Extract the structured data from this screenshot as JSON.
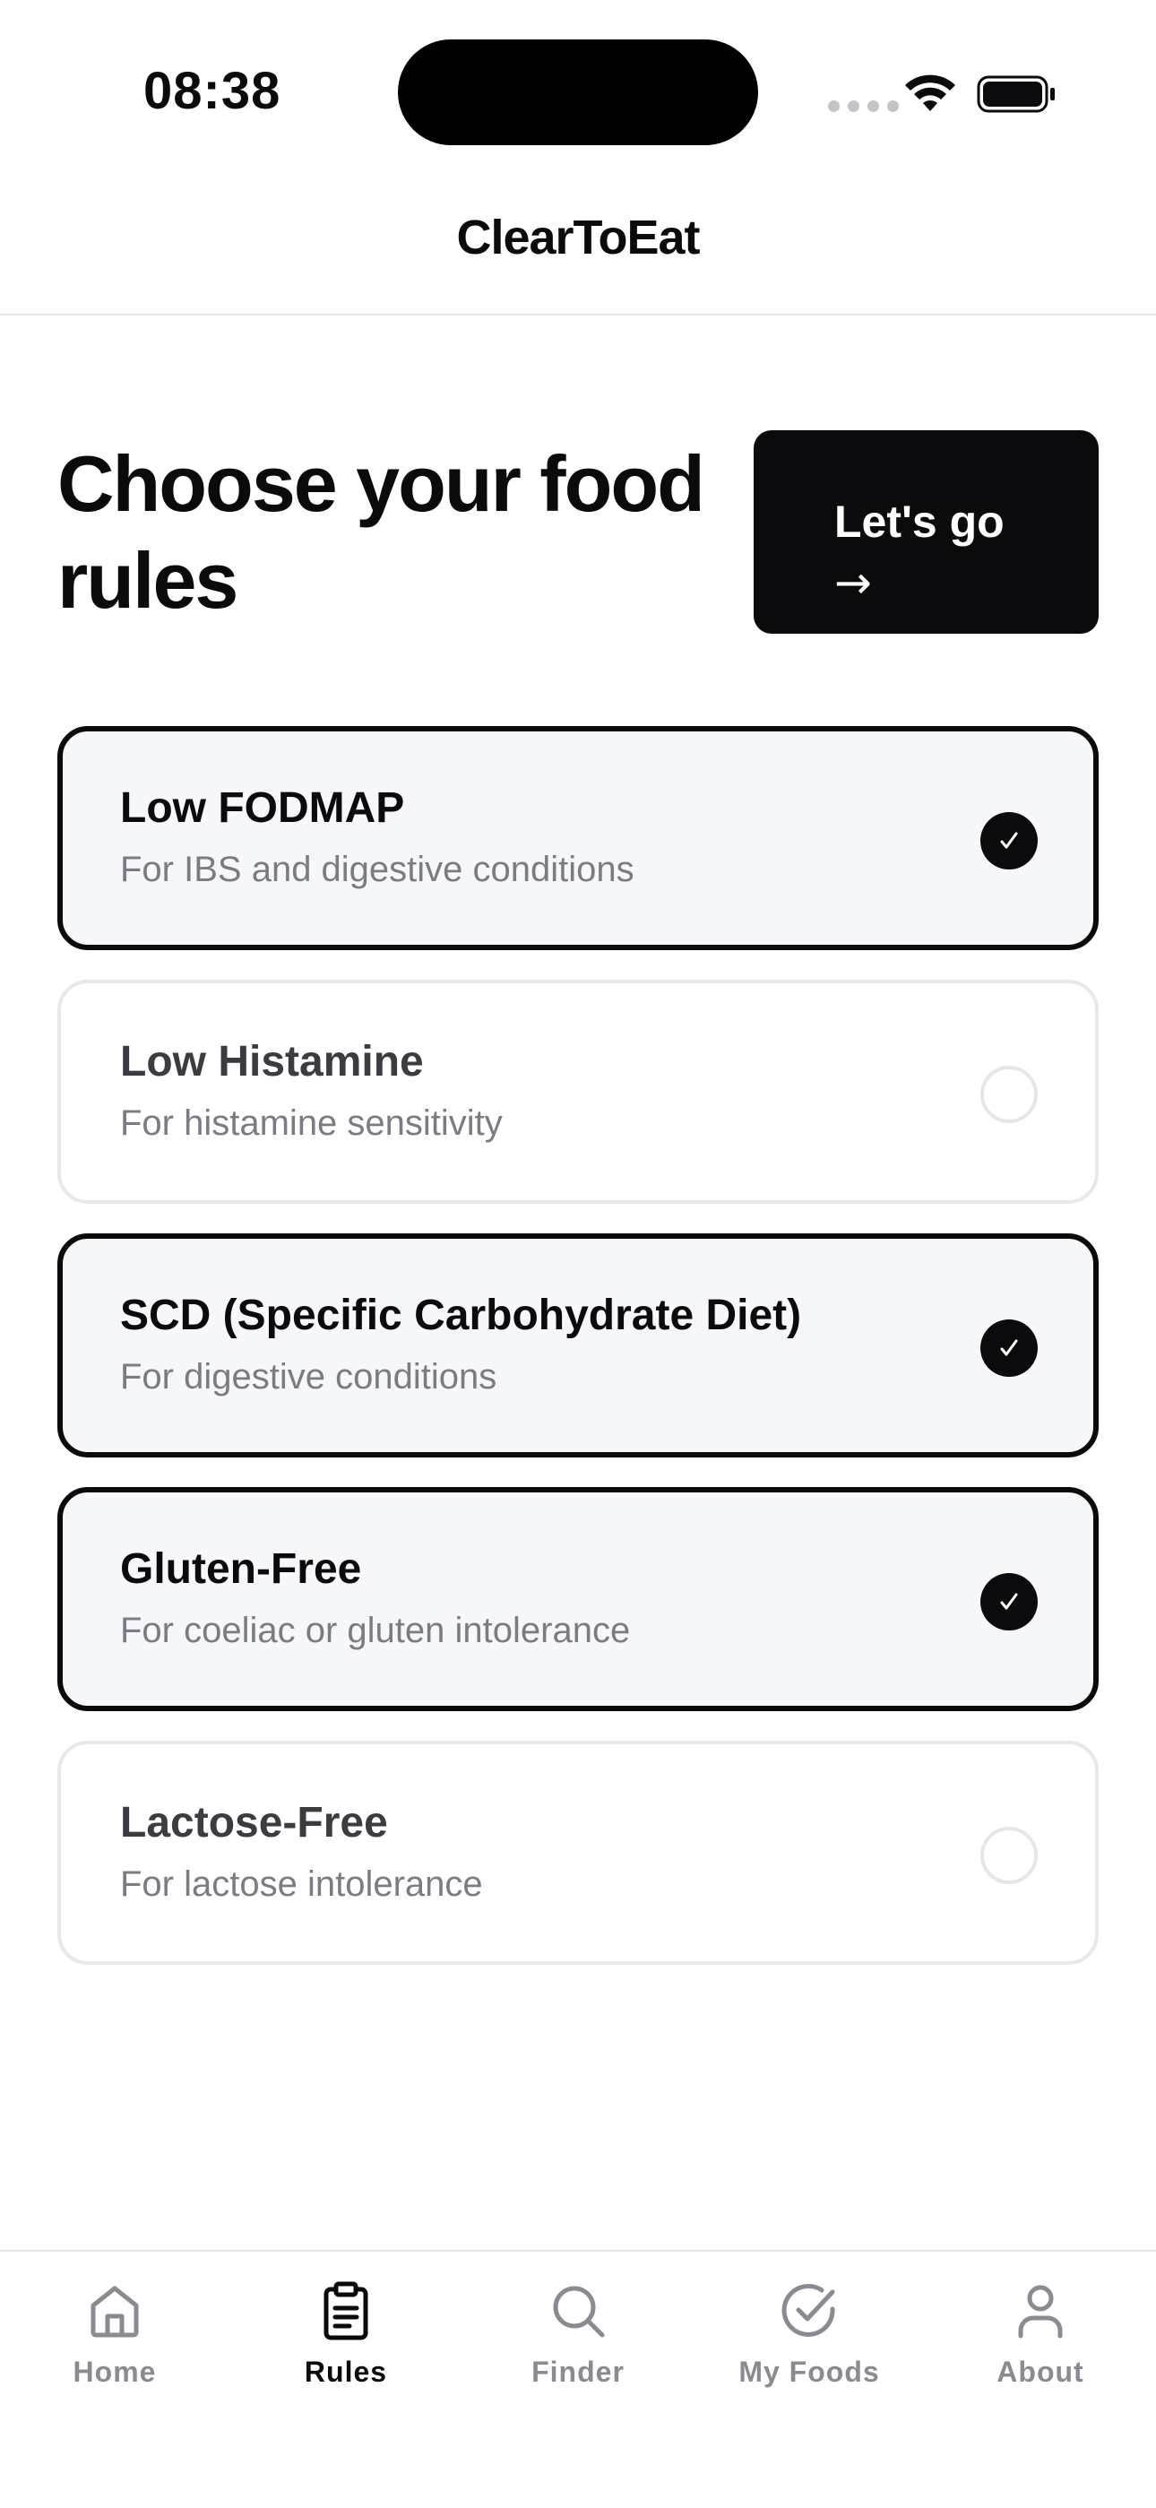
{
  "status_bar": {
    "time": "08:38"
  },
  "header": {
    "title": "ClearToEat"
  },
  "main": {
    "title": "Choose your food rules",
    "go_button_label": "Let's go",
    "go_button_arrow": "→"
  },
  "rules": [
    {
      "name": "Low FODMAP",
      "description": "For IBS and digestive conditions",
      "selected": true
    },
    {
      "name": "Low Histamine",
      "description": "For histamine sensitivity",
      "selected": false
    },
    {
      "name": "SCD (Specific Carbohydrate Diet)",
      "description": "For digestive conditions",
      "selected": true
    },
    {
      "name": "Gluten-Free",
      "description": "For coeliac or gluten intolerance",
      "selected": true
    },
    {
      "name": "Lactose-Free",
      "description": "For lactose intolerance",
      "selected": false
    }
  ],
  "tabs": [
    {
      "label": "Home",
      "icon": "home-icon",
      "active": false
    },
    {
      "label": "Rules",
      "icon": "clipboard-icon",
      "active": true
    },
    {
      "label": "Finder",
      "icon": "search-icon",
      "active": false
    },
    {
      "label": "My Foods",
      "icon": "check-circle-icon",
      "active": false
    },
    {
      "label": "About",
      "icon": "person-icon",
      "active": false
    }
  ],
  "colors": {
    "primary": "#0b0b0d",
    "selected_card_bg": "#f6f7f9",
    "muted_text": "#7b7b85",
    "inactive_tab": "#8a8a92",
    "border": "#e8e8ec"
  }
}
